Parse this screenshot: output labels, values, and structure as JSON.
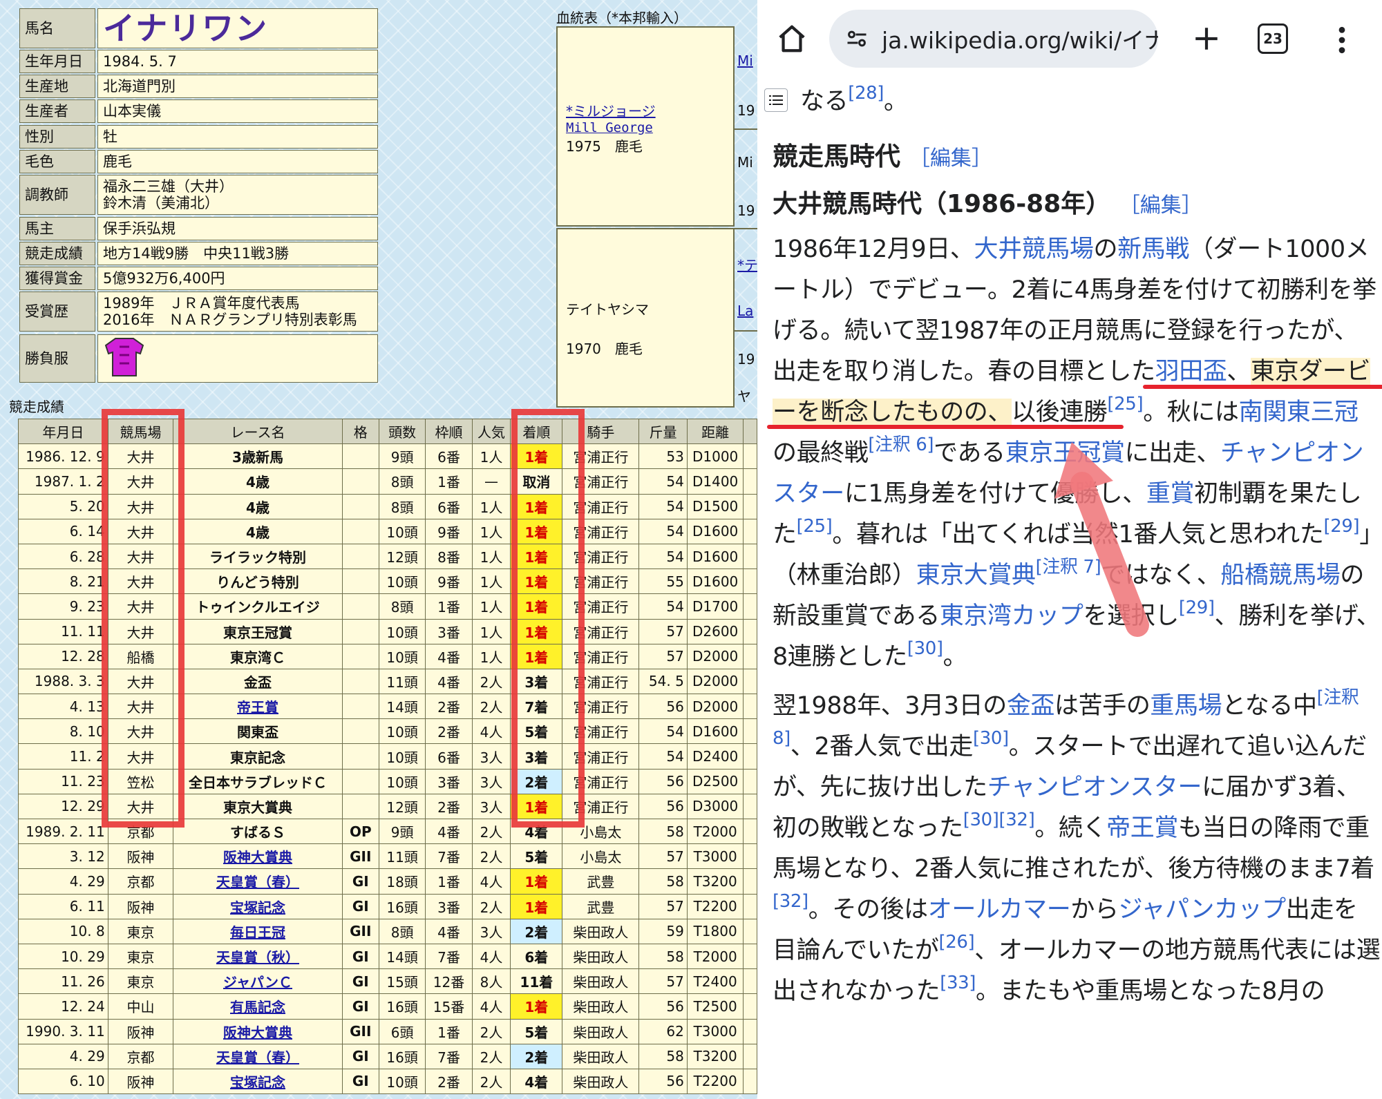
{
  "profile": {
    "rows": [
      {
        "label": "馬名",
        "value": "イナリワン"
      },
      {
        "label": "生年月日",
        "value": "1984. 5. 7"
      },
      {
        "label": "生産地",
        "value": "北海道門別"
      },
      {
        "label": "生産者",
        "value": "山本実儀"
      },
      {
        "label": "性別",
        "value": "牡"
      },
      {
        "label": "毛色",
        "value": "鹿毛"
      },
      {
        "label": "調教師",
        "lines": [
          "福永二三雄（大井）",
          "鈴木清（美浦北）"
        ]
      },
      {
        "label": "馬主",
        "value": "保手浜弘規"
      },
      {
        "label": "競走成績",
        "value": "地方14戦9勝　中央11戦3勝"
      },
      {
        "label": "獲得賞金",
        "value": "5億932万6,400円"
      },
      {
        "label": "受賞歴",
        "lines": [
          "1989年　ＪＲＡ賞年度代表馬",
          "2016年　ＮＡＲグランプリ特別表彰馬"
        ]
      },
      {
        "label": "勝負服",
        "icon": "jockey-silks-icon"
      }
    ]
  },
  "pedigree": {
    "caption": "血統表（*本邦輸入）",
    "sire": {
      "name": "*ミルジョージ",
      "name_en": "Mill George",
      "info": "1975　鹿毛"
    },
    "dam": {
      "name": "テイトヤシマ",
      "info": "1970　鹿毛"
    },
    "gs_fragments": [
      "Mi",
      "19",
      "Mi",
      "19",
      "*テ",
      "La",
      "19",
      "ヤ"
    ]
  },
  "race_table": {
    "caption": "競走成績",
    "headers": [
      "年月日",
      "競馬場",
      "レース名",
      "格",
      "頭数",
      "枠順",
      "人気",
      "着順",
      "騎手",
      "斤量",
      "距離"
    ],
    "rows": [
      [
        "1986. 12. 9",
        "大井",
        "3歳新馬",
        "",
        "9頭",
        "6番",
        "1人",
        "1着",
        "宮浦正行",
        "53",
        "D1000"
      ],
      [
        "1987. 1. 2",
        "大井",
        "4歳",
        "",
        "8頭",
        "1番",
        "—",
        "取消",
        "宮浦正行",
        "54",
        "D1400"
      ],
      [
        "5. 20",
        "大井",
        "4歳",
        "",
        "8頭",
        "6番",
        "1人",
        "1着",
        "宮浦正行",
        "54",
        "D1500"
      ],
      [
        "6. 14",
        "大井",
        "4歳",
        "",
        "10頭",
        "9番",
        "1人",
        "1着",
        "宮浦正行",
        "54",
        "D1600"
      ],
      [
        "6. 28",
        "大井",
        "ライラック特別",
        "",
        "12頭",
        "8番",
        "1人",
        "1着",
        "宮浦正行",
        "54",
        "D1600"
      ],
      [
        "8. 21",
        "大井",
        "りんどう特別",
        "",
        "10頭",
        "9番",
        "1人",
        "1着",
        "宮浦正行",
        "55",
        "D1600"
      ],
      [
        "9. 23",
        "大井",
        "トゥインクルエイジ",
        "",
        "8頭",
        "1番",
        "1人",
        "1着",
        "宮浦正行",
        "54",
        "D1700"
      ],
      [
        "11. 11",
        "大井",
        "東京王冠賞",
        "",
        "10頭",
        "3番",
        "1人",
        "1着",
        "宮浦正行",
        "57",
        "D2600"
      ],
      [
        "12. 28",
        "船橋",
        "東京湾Ｃ",
        "",
        "10頭",
        "4番",
        "1人",
        "1着",
        "宮浦正行",
        "57",
        "D2000"
      ],
      [
        "1988. 3. 3",
        "大井",
        "金盃",
        "",
        "11頭",
        "4番",
        "2人",
        "3着",
        "宮浦正行",
        "54. 5",
        "D2000"
      ],
      [
        "4. 13",
        "大井",
        "帝王賞",
        "",
        "14頭",
        "2番",
        "2人",
        "7着",
        "宮浦正行",
        "56",
        "D2000"
      ],
      [
        "8. 10",
        "大井",
        "関東盃",
        "",
        "10頭",
        "2番",
        "4人",
        "5着",
        "宮浦正行",
        "54",
        "D1600"
      ],
      [
        "11. 2",
        "大井",
        "東京記念",
        "",
        "10頭",
        "6番",
        "3人",
        "3着",
        "宮浦正行",
        "54",
        "D2400"
      ],
      [
        "11. 23",
        "笠松",
        "全日本サラブレッドＣ",
        "",
        "10頭",
        "3番",
        "3人",
        "2着",
        "宮浦正行",
        "56",
        "D2500"
      ],
      [
        "12. 29",
        "大井",
        "東京大賞典",
        "",
        "12頭",
        "2番",
        "3人",
        "1着",
        "宮浦正行",
        "56",
        "D3000"
      ],
      [
        "1989. 2. 11",
        "京都",
        "すばるＳ",
        "OP",
        "9頭",
        "4番",
        "2人",
        "4着",
        "小島太",
        "58",
        "T2000"
      ],
      [
        "3. 12",
        "阪神",
        "阪神大賞典",
        "GII",
        "11頭",
        "7番",
        "2人",
        "5着",
        "小島太",
        "57",
        "T3000"
      ],
      [
        "4. 29",
        "京都",
        "天皇賞（春）",
        "GI",
        "18頭",
        "1番",
        "4人",
        "1着",
        "武豊",
        "58",
        "T3200"
      ],
      [
        "6. 11",
        "阪神",
        "宝塚記念",
        "GI",
        "16頭",
        "3番",
        "2人",
        "1着",
        "武豊",
        "57",
        "T2200"
      ],
      [
        "10. 8",
        "東京",
        "毎日王冠",
        "GII",
        "8頭",
        "4番",
        "3人",
        "2着",
        "柴田政人",
        "59",
        "T1800"
      ],
      [
        "10. 29",
        "東京",
        "天皇賞（秋）",
        "GI",
        "14頭",
        "7番",
        "4人",
        "6着",
        "柴田政人",
        "58",
        "T2000"
      ],
      [
        "11. 26",
        "東京",
        "ジャパンＣ",
        "GI",
        "15頭",
        "12番",
        "8人",
        "11着",
        "柴田政人",
        "57",
        "T2400"
      ],
      [
        "12. 24",
        "中山",
        "有馬記念",
        "GI",
        "16頭",
        "15番",
        "4人",
        "1着",
        "柴田政人",
        "56",
        "T2500"
      ],
      [
        "1990. 3. 11",
        "阪神",
        "阪神大賞典",
        "GII",
        "6頭",
        "1番",
        "2人",
        "5着",
        "柴田政人",
        "62",
        "T3000"
      ],
      [
        "4. 29",
        "京都",
        "天皇賞（春）",
        "GI",
        "16頭",
        "7番",
        "2人",
        "2着",
        "柴田政人",
        "58",
        "T3200"
      ],
      [
        "6. 10",
        "阪神",
        "宝塚記念",
        "GI",
        "10頭",
        "2番",
        "2人",
        "4着",
        "柴田政人",
        "56",
        "T2200"
      ]
    ],
    "linked_races": [
      "帝王賞",
      "阪神大賞典",
      "天皇賞（春）",
      "宝塚記念",
      "毎日王冠",
      "天皇賞（秋）",
      "ジャパンＣ",
      "有馬記念"
    ]
  },
  "browser": {
    "url": "ja.wikipedia.org/wiki/イナ",
    "tab_count": "23"
  },
  "article": {
    "lead_tail": "なる",
    "lead_ref": "[28]",
    "lead_end": "。",
    "h2": "競走馬時代",
    "edit": "［編集］",
    "h3": "大井競馬時代（1986-88年）",
    "p1": {
      "s1": "1986年12月9日、",
      "l1": "大井競馬場",
      "s2": "の",
      "l2": "新馬戦",
      "s3": "（ダート1000メートル）でデビュー。2着に4馬身差を付けて初勝利を挙げる。続いて翌1987年の正月競馬に登録を行ったが、出走を取り消した。",
      "s4": "春の目標とした",
      "l3": "羽田盃",
      "s5": "、",
      "s6": "東京ダービーを断念したものの、",
      "s7": "以後連勝",
      "r1": "[25]",
      "s8": "。秋には",
      "l4": "南関東三冠",
      "s9": "の最終戦",
      "r2": "[注釈 6]",
      "s10": "である",
      "l5": "東京王冠賞",
      "s11": "に出走、",
      "l6": "チャンピオンスター",
      "s12": "に1馬身差を付けて優勝し、",
      "l7": "重賞",
      "s13": "初制覇を果たした",
      "r3": "[25]",
      "s14": "。暮れは「出てくれば当然1番人気と思われた",
      "r4": "[29]",
      "s15": "」（林重治郎）",
      "l8": "東京大賞典",
      "r5": "[注釈 7]",
      "s16": "ではなく、",
      "l9": "船橋競馬場",
      "s17": "の新設重賞である",
      "l10": "東京湾カップ",
      "s18": "を選択し",
      "r6": "[29]",
      "s19": "、勝利を挙げ、8連勝とした",
      "r7": "[30]",
      "s20": "。"
    },
    "p2": {
      "s1": "翌1988年、3月3日の",
      "l1": "金盃",
      "s2": "は苦手の",
      "l2": "重馬場",
      "s3": "となる中",
      "r1": "[注釈 8]",
      "s4": "、2番人気で出走",
      "r2": "[30]",
      "s5": "。スタートで出遅れて追い込んだが、先に抜け出した",
      "l3": "チャンピオンスター",
      "s6": "に届かず3着、初の敗戦となった",
      "r3": "[30]",
      "r4": "[32]",
      "s7": "。続く",
      "l4": "帝王賞",
      "s8": "も当日の降雨で重馬場となり、2番人気に推されたが、後方待機のまま7着",
      "r5": "[32]",
      "s9": "。その後は",
      "l5": "オールカマー",
      "s10": "から",
      "l6": "ジャパンカップ",
      "s11": "出走を目論んでいたが",
      "r6": "[26]",
      "s12": "、オールカマーの地方競馬代表には選出されなかった",
      "r7": "[33]",
      "s13": "。またもや重馬場となった8月の"
    }
  },
  "colors": {
    "annotation_red": "#e6232d",
    "link_blue": "#3366cc",
    "win_yellow": "#fff12a"
  }
}
